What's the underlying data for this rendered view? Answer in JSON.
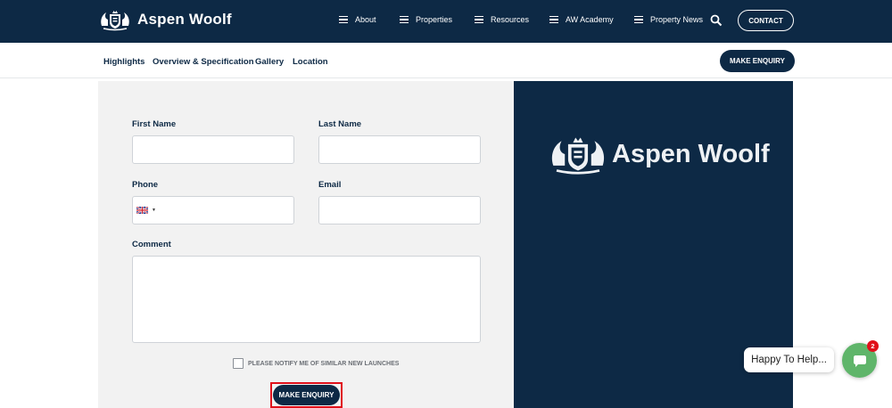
{
  "header": {
    "brand": "Aspen Woolf",
    "nav": [
      {
        "label": "About"
      },
      {
        "label": "Properties"
      },
      {
        "label": "Resources"
      },
      {
        "label": "AW Academy"
      },
      {
        "label": "Property News"
      }
    ],
    "contact_label": "CONTACT"
  },
  "subnav": {
    "links": [
      {
        "label": "Highlights"
      },
      {
        "label": "Overview & Specification"
      },
      {
        "label": "Gallery"
      },
      {
        "label": "Location"
      }
    ],
    "enquiry_label": "MAKE ENQUIRY"
  },
  "form": {
    "first_name_label": "First Name",
    "first_name_value": "",
    "last_name_label": "Last Name",
    "last_name_value": "",
    "phone_label": "Phone",
    "phone_value": "",
    "email_label": "Email",
    "email_value": "",
    "comment_label": "Comment",
    "comment_value": "",
    "notify_label": "PLEASE NOTIFY ME OF SIMILAR NEW LAUNCHES",
    "notify_checked": false,
    "submit_label": "MAKE ENQUIRY"
  },
  "brand_panel": {
    "logo_text": "Aspen Woolf"
  },
  "chat": {
    "bubble_text": "Happy To Help...",
    "badge_count": "2"
  },
  "colors": {
    "navy": "#0d2945",
    "form_bg": "#f2f2f2",
    "chat_green": "#5fb56a",
    "badge_red": "#e0101a",
    "highlight_outline": "#e0101a"
  },
  "icons": [
    "crest-logo-icon",
    "menu-icon",
    "search-icon",
    "uk-flag-icon",
    "chat-icon"
  ]
}
